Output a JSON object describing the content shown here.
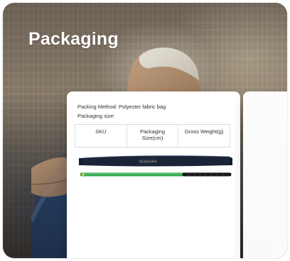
{
  "header": {
    "title": "Packaging"
  },
  "packaging_card": {
    "packing_method": "Packing Method: Polyester fabric bag",
    "packaging_size_label": "Packaging size:",
    "table": {
      "headers": [
        "SKU",
        "Packaging Size(cm)",
        "Gross Weight(g)"
      ]
    },
    "bag_label": "TELESCOPIC"
  }
}
